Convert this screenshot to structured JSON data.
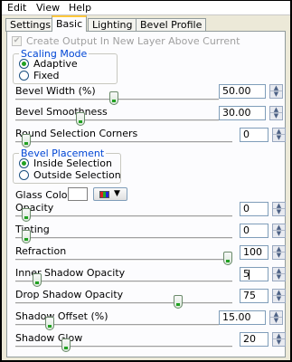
{
  "menu": [
    "Edit",
    "View",
    "Help"
  ],
  "tabs": [
    "Settings",
    "Basic",
    "Lighting",
    "Bevel Profile"
  ],
  "active_tab": "Basic",
  "create_output": {
    "label": "Create Output In New Layer Above Current",
    "checked": true,
    "enabled": false
  },
  "scaling_mode": {
    "title": "Scaling Mode",
    "options": [
      "Adaptive",
      "Fixed"
    ],
    "selected": "Adaptive"
  },
  "bevel_width": {
    "label": "Bevel Width (%)",
    "value": "50.00",
    "fraction": 0.5
  },
  "bevel_smoothness": {
    "label": "Bevel Smoothness",
    "value": "30.00",
    "fraction": 0.3
  },
  "round_corners": {
    "label": "Round Selection Corners",
    "value": "0",
    "fraction": 0.0
  },
  "bevel_placement": {
    "title": "Bevel Placement",
    "options": [
      "Inside Selection",
      "Outside Selection"
    ],
    "selected": "Inside Selection"
  },
  "glass_color": {
    "label": "Glass Color",
    "color": "#ffffff"
  },
  "opacity": {
    "label": "Opacity",
    "value": "0",
    "fraction": 0.0
  },
  "tinting": {
    "label": "Tinting",
    "value": "0",
    "fraction": 0.0
  },
  "refraction": {
    "label": "Refraction",
    "value": "100",
    "fraction": 1.0
  },
  "inner_shadow_opacity": {
    "label": "Inner Shadow Opacity",
    "value": "5",
    "fraction": 0.05
  },
  "drop_shadow_opacity": {
    "label": "Drop Shadow Opacity",
    "value": "75",
    "fraction": 0.75
  },
  "shadow_offset": {
    "label": "Shadow Offset (%)",
    "value": "15.00",
    "fraction": 0.15
  },
  "shadow_glow": {
    "label": "Shadow Glow",
    "value": "20",
    "fraction": 0.2
  },
  "colors": {
    "accent_green": "#21a121",
    "legend_blue": "#0046d5",
    "tab_highlight": "#ffc83c"
  }
}
